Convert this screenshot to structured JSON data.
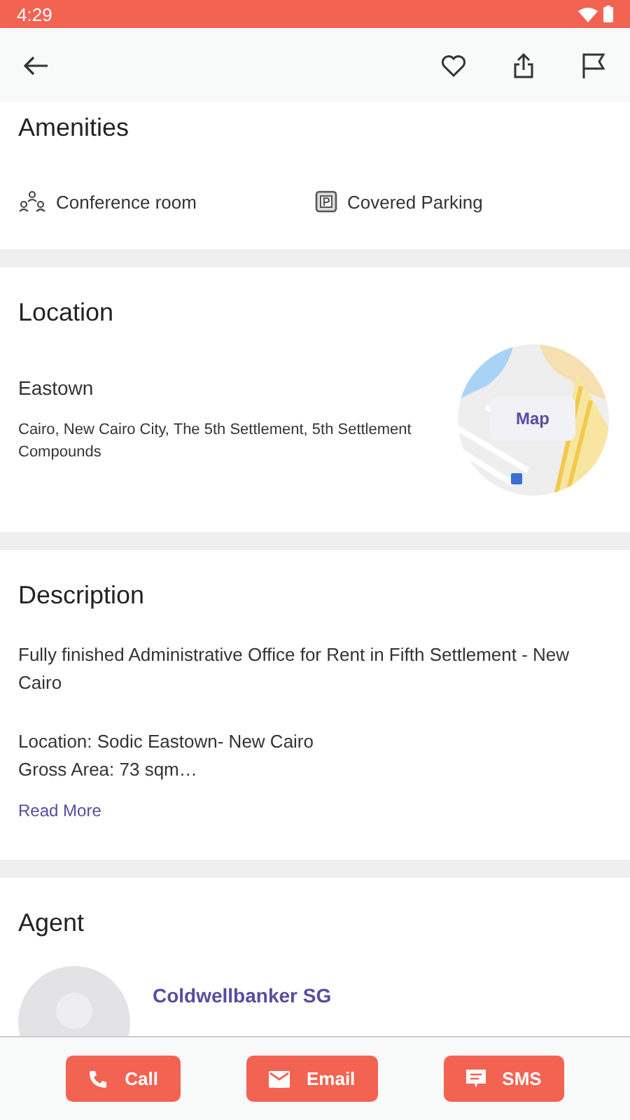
{
  "status_bar": {
    "time": "4:29"
  },
  "amenities": {
    "title": "Amenities",
    "items": [
      {
        "kind": "conference",
        "label": "Conference room"
      },
      {
        "kind": "parking",
        "label": "Covered Parking"
      }
    ]
  },
  "location": {
    "title": "Location",
    "name": "Eastown",
    "address": "Cairo, New Cairo City, The 5th Settlement, 5th Settlement Compounds",
    "map_label": "Map"
  },
  "description": {
    "title": "Description",
    "paragraphs": [
      "Fully finished Administrative Office for Rent in Fifth Settlement - New Cairo",
      "Location: Sodic Eastown- New Cairo\nGross Area: 73 sqm…"
    ],
    "more": "Read More"
  },
  "agent": {
    "title": "Agent",
    "name": "Coldwellbanker SG"
  },
  "actions": [
    {
      "kind": "call",
      "label": "Call"
    },
    {
      "kind": "email",
      "label": "Email"
    },
    {
      "kind": "sms",
      "label": "SMS"
    }
  ]
}
